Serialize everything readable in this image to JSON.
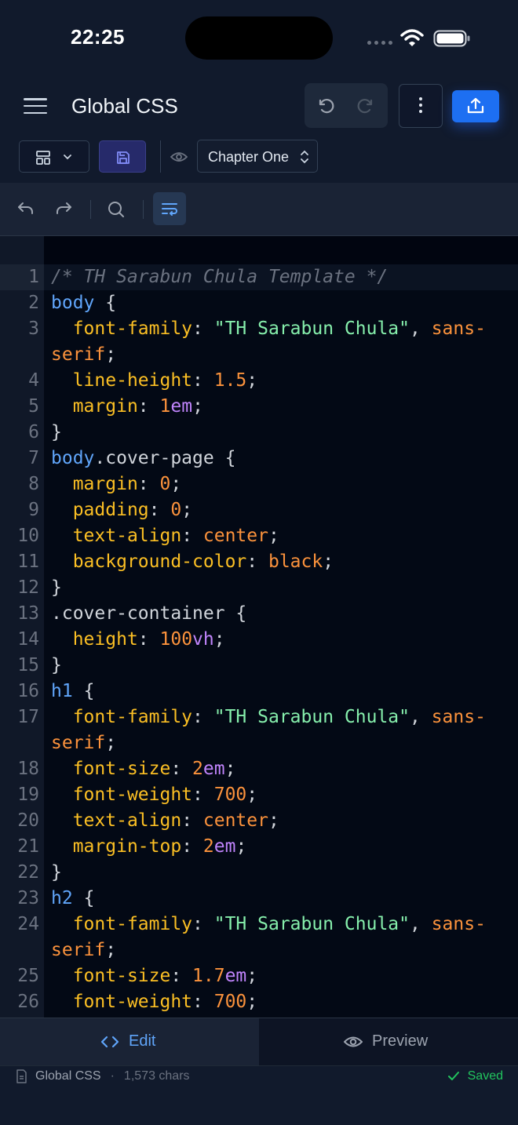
{
  "status_bar": {
    "time": "22:25"
  },
  "header": {
    "title": "Global CSS",
    "chapter_select": "Chapter One"
  },
  "code_lines": [
    {
      "n": "1",
      "html": "<span class='c-comment'>/* TH Sarabun Chula Template */</span>"
    },
    {
      "n": "2",
      "html": "<span class='c-sel'>body</span> <span class='c-punc'>{</span>"
    },
    {
      "n": "3",
      "html": "  <span class='c-prop'>font-family</span>: <span class='c-str'>\"TH Sarabun Chula\"</span>, <span class='c-kw'>sans-</span>"
    },
    {
      "n": "",
      "html": "<span class='c-kw'>serif</span>;"
    },
    {
      "n": "4",
      "html": "  <span class='c-prop'>line-height</span>: <span class='c-num'>1.5</span>;"
    },
    {
      "n": "5",
      "html": "  <span class='c-prop'>margin</span>: <span class='c-num'>1</span><span class='c-unit'>em</span>;"
    },
    {
      "n": "6",
      "html": "<span class='c-punc'>}</span>"
    },
    {
      "n": "7",
      "html": "<span class='c-sel'>body</span>.cover-page <span class='c-punc'>{</span>"
    },
    {
      "n": "8",
      "html": "  <span class='c-prop'>margin</span>: <span class='c-num'>0</span>;"
    },
    {
      "n": "9",
      "html": "  <span class='c-prop'>padding</span>: <span class='c-num'>0</span>;"
    },
    {
      "n": "10",
      "html": "  <span class='c-prop'>text-align</span>: <span class='c-kw'>center</span>;"
    },
    {
      "n": "11",
      "html": "  <span class='c-prop'>background-color</span>: <span class='c-kw'>black</span>;"
    },
    {
      "n": "12",
      "html": "<span class='c-punc'>}</span>"
    },
    {
      "n": "13",
      "html": ".cover-container <span class='c-punc'>{</span>"
    },
    {
      "n": "14",
      "html": "  <span class='c-prop'>height</span>: <span class='c-num'>100</span><span class='c-unit'>vh</span>;"
    },
    {
      "n": "15",
      "html": "<span class='c-punc'>}</span>"
    },
    {
      "n": "16",
      "html": "<span class='c-sel'>h1</span> <span class='c-punc'>{</span>"
    },
    {
      "n": "17",
      "html": "  <span class='c-prop'>font-family</span>: <span class='c-str'>\"TH Sarabun Chula\"</span>, <span class='c-kw'>sans-</span>"
    },
    {
      "n": "",
      "html": "<span class='c-kw'>serif</span>;"
    },
    {
      "n": "18",
      "html": "  <span class='c-prop'>font-size</span>: <span class='c-num'>2</span><span class='c-unit'>em</span>;"
    },
    {
      "n": "19",
      "html": "  <span class='c-prop'>font-weight</span>: <span class='c-num'>700</span>;"
    },
    {
      "n": "20",
      "html": "  <span class='c-prop'>text-align</span>: <span class='c-kw'>center</span>;"
    },
    {
      "n": "21",
      "html": "  <span class='c-prop'>margin-top</span>: <span class='c-num'>2</span><span class='c-unit'>em</span>;"
    },
    {
      "n": "22",
      "html": "<span class='c-punc'>}</span>"
    },
    {
      "n": "23",
      "html": "<span class='c-sel'>h2</span> <span class='c-punc'>{</span>"
    },
    {
      "n": "24",
      "html": "  <span class='c-prop'>font-family</span>: <span class='c-str'>\"TH Sarabun Chula\"</span>, <span class='c-kw'>sans-</span>"
    },
    {
      "n": "",
      "html": "<span class='c-kw'>serif</span>;"
    },
    {
      "n": "25",
      "html": "  <span class='c-prop'>font-size</span>: <span class='c-num'>1.7</span><span class='c-unit'>em</span>;"
    },
    {
      "n": "26",
      "html": "  <span class='c-prop'>font-weight</span>: <span class='c-num'>700</span>;"
    }
  ],
  "tabs": {
    "edit": "Edit",
    "preview": "Preview"
  },
  "footer": {
    "file": "Global CSS",
    "separator": "·",
    "chars": "1,573 chars",
    "saved": "Saved"
  },
  "colors": {
    "accent": "#1d6ff2",
    "active_tab": "#60a5fa",
    "saved": "#22c55e"
  }
}
